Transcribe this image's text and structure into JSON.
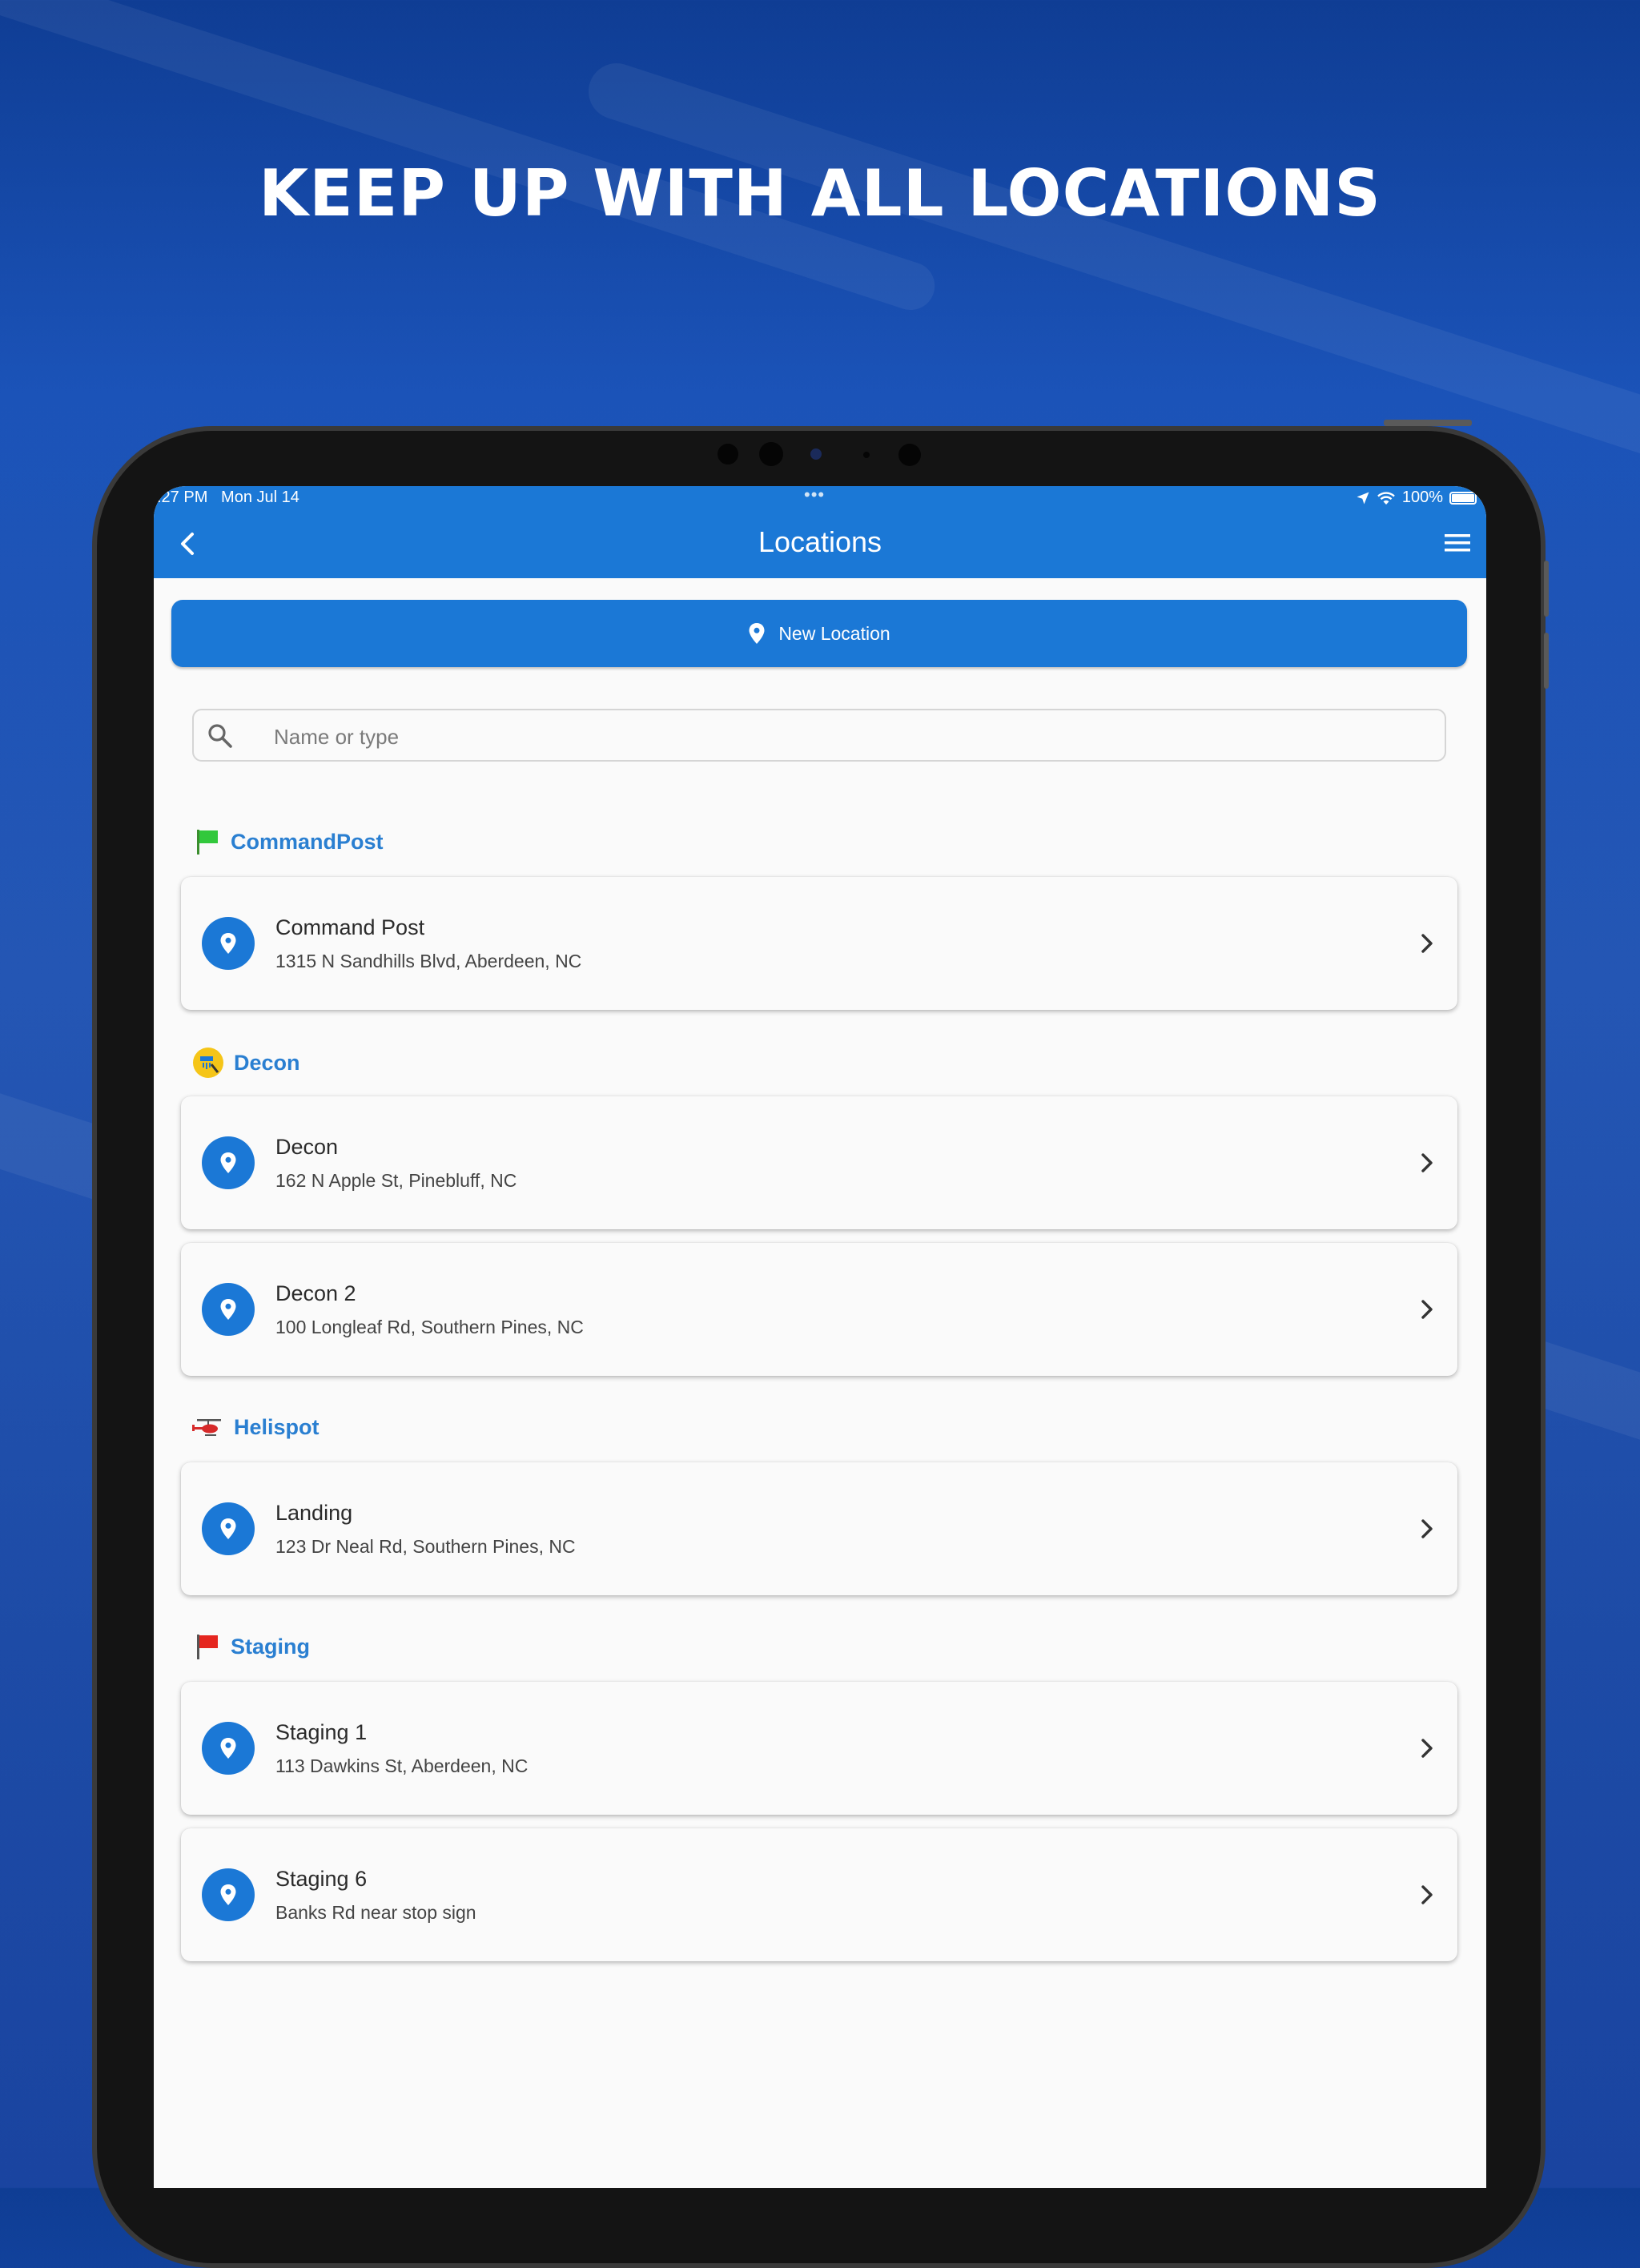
{
  "headline": "KEEP UP WITH ALL LOCATIONS",
  "status_bar": {
    "time": ":27 PM",
    "date": "Mon Jul 14",
    "battery": "100%"
  },
  "appbar": {
    "title": "Locations"
  },
  "new_location_label": "New Location",
  "search": {
    "placeholder": "Name or type",
    "value": ""
  },
  "sections": [
    {
      "name": "CommandPost",
      "icon": "green-flag-icon",
      "items": [
        {
          "name": "Command Post",
          "address": "1315 N Sandhills Blvd, Aberdeen, NC"
        }
      ]
    },
    {
      "name": "Decon",
      "icon": "decon-shower-icon",
      "items": [
        {
          "name": "Decon",
          "address": "162 N Apple St, Pinebluff, NC"
        },
        {
          "name": "Decon 2",
          "address": "100 Longleaf Rd, Southern Pines, NC"
        }
      ]
    },
    {
      "name": "Helispot",
      "icon": "helicopter-icon",
      "items": [
        {
          "name": "Landing",
          "address": "123 Dr Neal Rd, Southern Pines, NC"
        }
      ]
    },
    {
      "name": "Staging",
      "icon": "red-flag-icon",
      "items": [
        {
          "name": "Staging 1",
          "address": "113 Dawkins St, Aberdeen, NC"
        },
        {
          "name": "Staging 6",
          "address": "Banks Rd near stop sign"
        }
      ]
    }
  ],
  "colors": {
    "primary": "#1b78d6",
    "section_label": "#2a7fd1",
    "background_blue": "#1b53b8"
  }
}
